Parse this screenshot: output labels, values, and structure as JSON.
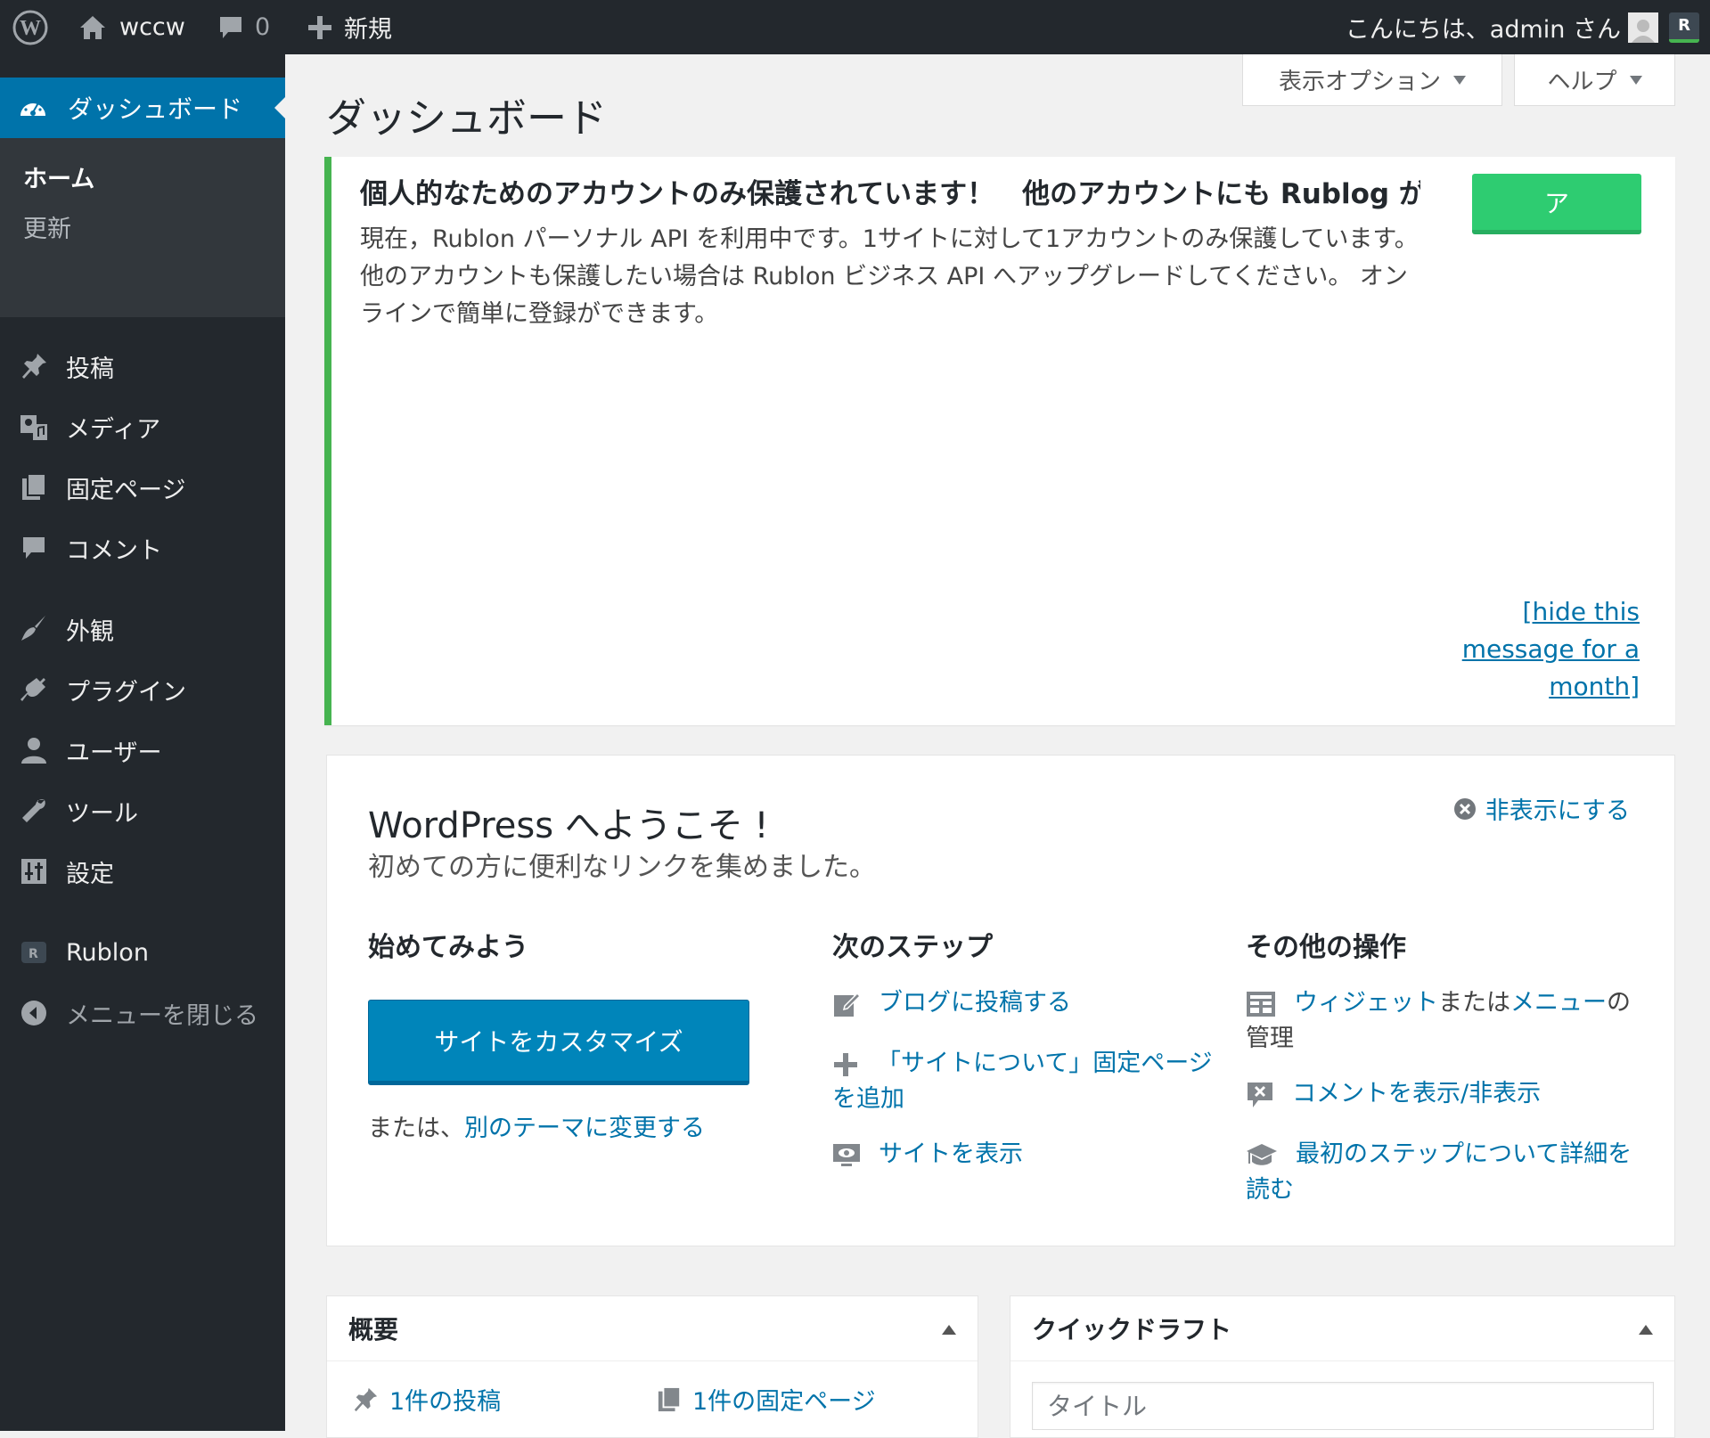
{
  "adminbar": {
    "site_name": "wccw",
    "comments_count": "0",
    "new_label": "新規",
    "greeting": "こんにちは、admin さん",
    "rublon_badge": "R"
  },
  "sidebar": {
    "dashboard": "ダッシュボード",
    "submenu": [
      "ホーム",
      "更新"
    ],
    "items": [
      {
        "label": "投稿",
        "icon": "pin-icon"
      },
      {
        "label": "メディア",
        "icon": "media-icon"
      },
      {
        "label": "固定ページ",
        "icon": "page-icon"
      },
      {
        "label": "コメント",
        "icon": "comment-icon"
      },
      {
        "label": "外観",
        "icon": "brush-icon"
      },
      {
        "label": "プラグイン",
        "icon": "plugin-icon"
      },
      {
        "label": "ユーザー",
        "icon": "user-icon"
      },
      {
        "label": "ツール",
        "icon": "wrench-icon"
      },
      {
        "label": "設定",
        "icon": "settings-icon"
      },
      {
        "label": "Rublon",
        "icon": "rublon-icon"
      },
      {
        "label": "メニューを閉じる",
        "icon": "collapse-icon"
      }
    ]
  },
  "header": {
    "screen_options": "表示オプション",
    "help": "ヘルプ",
    "title": "ダッシュボード"
  },
  "notice": {
    "title": "個人的なためのアカウントのみ保護されています！　他のアカウントにも Rublog が適",
    "text": "現在，Rublon パーソナル API を利用中です。1サイトに対して1アカウントのみ保護しています。他のアカウントも保護したい場合は Rublon ビジネス API へアップグレードしてください。 オンラインで簡単に登録ができます。",
    "button": "ア",
    "hide_link": "[hide this message for a month]"
  },
  "welcome": {
    "title": "WordPress へようこそ !",
    "subtitle": "初めての方に便利なリンクを集めました。",
    "dismiss": "非表示にする",
    "col1_title": "始めてみよう",
    "customize_button": "サイトをカスタマイズ",
    "or_text": "または、",
    "change_theme": "別のテーマに変更する",
    "col2_title": "次のステップ",
    "next_steps": [
      "ブログに投稿する",
      "「サイトについて」固定ページを追加",
      "サイトを表示"
    ],
    "col3_title": "その他の操作",
    "more_actions": [
      "ウィジェットまたはメニューの管理",
      "コメントを表示/非表示",
      "最初のステップについて詳細を読む"
    ],
    "widgets_text": "ウィジェット",
    "or_word": "または",
    "menus_text": "メニュー",
    "manage_text": "の管理"
  },
  "glance": {
    "title": "概要",
    "posts": "1件の投稿",
    "pages": "1件の固定ページ"
  },
  "quickdraft": {
    "title": "クイックドラフト",
    "title_placeholder": "タイトル"
  },
  "colors": {
    "adminbar_bg": "#23282d",
    "accent": "#0073aa",
    "notice_border": "#46b450",
    "upgrade_button": "#2ecc71"
  }
}
